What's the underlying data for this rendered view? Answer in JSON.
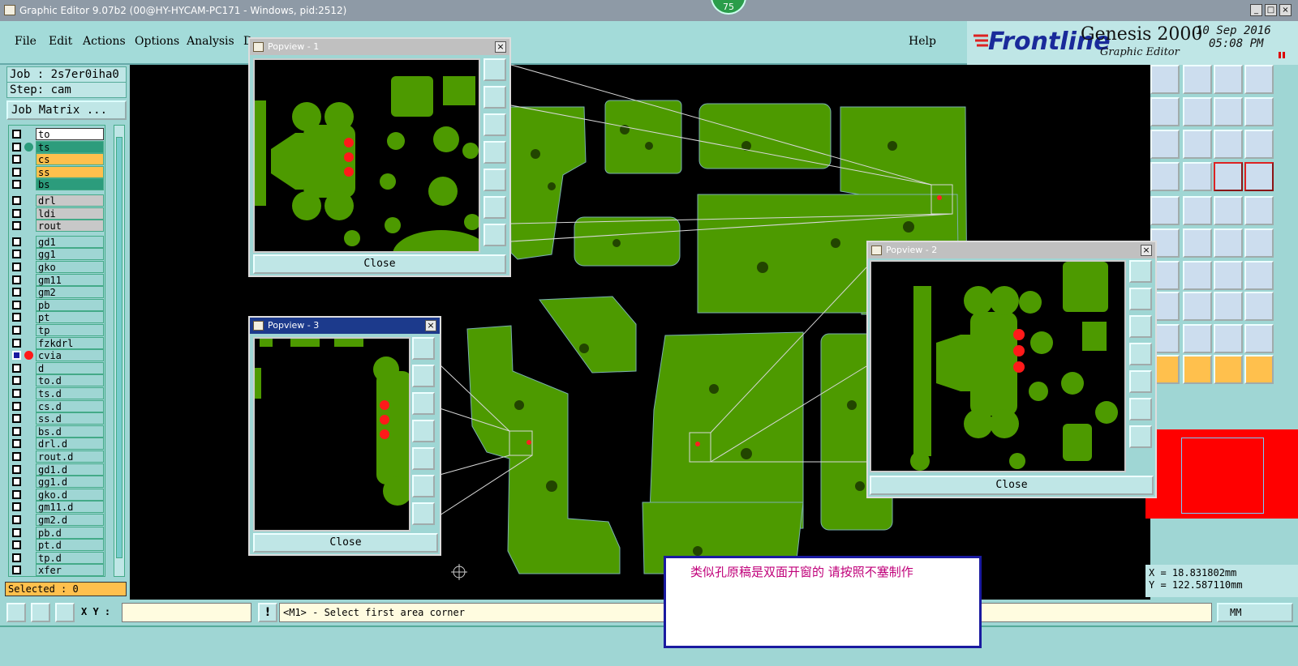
{
  "window": {
    "title": "Graphic Editor 9.07b2 (00@HY-HYCAM-PC171 - Windows, pid:2512)",
    "badge": "75"
  },
  "menu": {
    "items": [
      "File",
      "Edit",
      "Actions",
      "Options",
      "Analysis",
      "D"
    ],
    "help": "Help"
  },
  "brand": {
    "logo": "Frontline",
    "product": "Genesis 2000",
    "subtitle": "Graphic Editor",
    "date": "10 Sep 2016",
    "time": "05:08 PM"
  },
  "job": {
    "job_label": "Job : 2s7er0iha0",
    "step_label": "Step: cam",
    "matrix_button": "Job Matrix ..."
  },
  "layers": [
    "to",
    "ts",
    "cs",
    "ss",
    "bs",
    "drl",
    "ldi",
    "rout",
    "gd1",
    "gg1",
    "gko",
    "gm11",
    "gm2",
    "pb",
    "pt",
    "tp",
    "fzkdrl",
    "cvia",
    "d",
    "to.d",
    "ts.d",
    "cs.d",
    "ss.d",
    "bs.d",
    "drl.d",
    "rout.d",
    "gd1.d",
    "gg1.d",
    "gko.d",
    "gm11.d",
    "gm2.d",
    "pb.d",
    "pt.d",
    "tp.d",
    "xfer"
  ],
  "selected": "Selected : 0",
  "bottom": {
    "xy_label": "X Y :",
    "prompt": "<M1> - Select first area corner",
    "unit": "MM"
  },
  "coords": {
    "x": "X = 18.831802mm",
    "y": "Y = 122.587110mm"
  },
  "popups": [
    {
      "title": "Popview - 1",
      "close": "Close"
    },
    {
      "title": "Popview - 2",
      "close": "Close"
    },
    {
      "title": "Popview - 3",
      "close": "Close"
    }
  ],
  "note": "类似孔原稿是双面开窗的      请按照不塞制作",
  "colors": {
    "copper": "#4d9a00",
    "pad_red": "#ff1a1a",
    "panel": "#9fd6d4",
    "highlight": "#ff0000"
  }
}
